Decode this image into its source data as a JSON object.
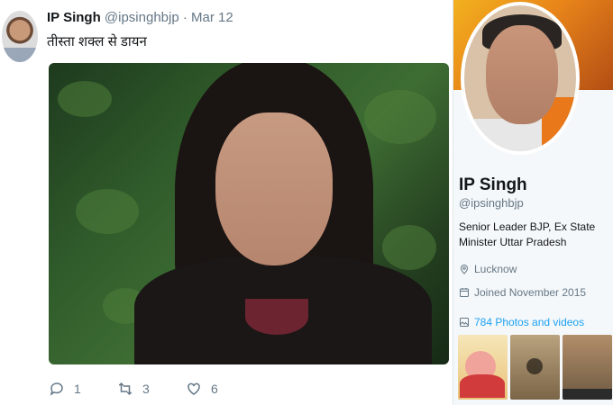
{
  "tweet": {
    "author_name": "IP Singh",
    "handle": "@ipsinghbjp",
    "separator": "·",
    "date": "Mar 12",
    "text": "तीस्ता शक्ल से डायन",
    "actions": {
      "replies": "1",
      "retweets": "3",
      "likes": "6"
    }
  },
  "profile": {
    "name": "IP Singh",
    "handle": "@ipsinghbjp",
    "bio": "Senior Leader BJP, Ex State Minister Uttar Pradesh",
    "location": "Lucknow",
    "joined": "Joined November 2015",
    "photos": "784 Photos and videos"
  },
  "icons": {
    "reply": "reply-icon",
    "retweet": "retweet-icon",
    "like": "heart-icon",
    "location": "location-pin-icon",
    "calendar": "calendar-icon",
    "media": "image-icon"
  },
  "colors": {
    "link": "#1da1f2",
    "secondary_text": "#657786",
    "primary_text": "#14171a"
  }
}
